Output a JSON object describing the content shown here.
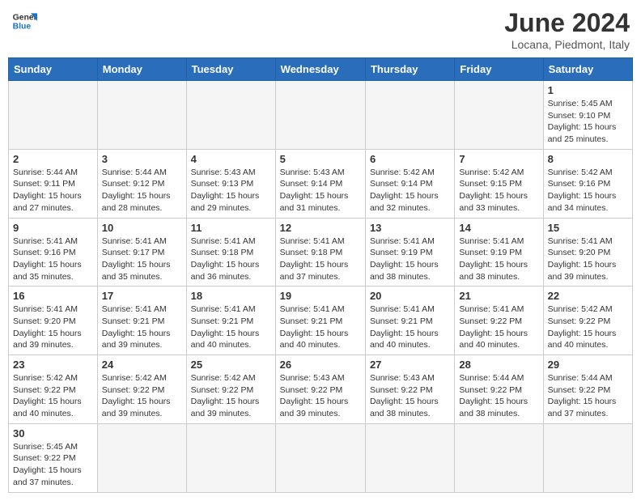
{
  "header": {
    "logo_general": "General",
    "logo_blue": "Blue",
    "title": "June 2024",
    "subtitle": "Locana, Piedmont, Italy"
  },
  "days_of_week": [
    "Sunday",
    "Monday",
    "Tuesday",
    "Wednesday",
    "Thursday",
    "Friday",
    "Saturday"
  ],
  "weeks": [
    [
      {
        "day": "",
        "info": ""
      },
      {
        "day": "",
        "info": ""
      },
      {
        "day": "",
        "info": ""
      },
      {
        "day": "",
        "info": ""
      },
      {
        "day": "",
        "info": ""
      },
      {
        "day": "",
        "info": ""
      },
      {
        "day": "1",
        "info": "Sunrise: 5:45 AM\nSunset: 9:10 PM\nDaylight: 15 hours and 25 minutes."
      }
    ],
    [
      {
        "day": "2",
        "info": "Sunrise: 5:44 AM\nSunset: 9:11 PM\nDaylight: 15 hours and 27 minutes."
      },
      {
        "day": "3",
        "info": "Sunrise: 5:44 AM\nSunset: 9:12 PM\nDaylight: 15 hours and 28 minutes."
      },
      {
        "day": "4",
        "info": "Sunrise: 5:43 AM\nSunset: 9:13 PM\nDaylight: 15 hours and 29 minutes."
      },
      {
        "day": "5",
        "info": "Sunrise: 5:43 AM\nSunset: 9:14 PM\nDaylight: 15 hours and 31 minutes."
      },
      {
        "day": "6",
        "info": "Sunrise: 5:42 AM\nSunset: 9:14 PM\nDaylight: 15 hours and 32 minutes."
      },
      {
        "day": "7",
        "info": "Sunrise: 5:42 AM\nSunset: 9:15 PM\nDaylight: 15 hours and 33 minutes."
      },
      {
        "day": "8",
        "info": "Sunrise: 5:42 AM\nSunset: 9:16 PM\nDaylight: 15 hours and 34 minutes."
      }
    ],
    [
      {
        "day": "9",
        "info": "Sunrise: 5:41 AM\nSunset: 9:16 PM\nDaylight: 15 hours and 35 minutes."
      },
      {
        "day": "10",
        "info": "Sunrise: 5:41 AM\nSunset: 9:17 PM\nDaylight: 15 hours and 35 minutes."
      },
      {
        "day": "11",
        "info": "Sunrise: 5:41 AM\nSunset: 9:18 PM\nDaylight: 15 hours and 36 minutes."
      },
      {
        "day": "12",
        "info": "Sunrise: 5:41 AM\nSunset: 9:18 PM\nDaylight: 15 hours and 37 minutes."
      },
      {
        "day": "13",
        "info": "Sunrise: 5:41 AM\nSunset: 9:19 PM\nDaylight: 15 hours and 38 minutes."
      },
      {
        "day": "14",
        "info": "Sunrise: 5:41 AM\nSunset: 9:19 PM\nDaylight: 15 hours and 38 minutes."
      },
      {
        "day": "15",
        "info": "Sunrise: 5:41 AM\nSunset: 9:20 PM\nDaylight: 15 hours and 39 minutes."
      }
    ],
    [
      {
        "day": "16",
        "info": "Sunrise: 5:41 AM\nSunset: 9:20 PM\nDaylight: 15 hours and 39 minutes."
      },
      {
        "day": "17",
        "info": "Sunrise: 5:41 AM\nSunset: 9:21 PM\nDaylight: 15 hours and 39 minutes."
      },
      {
        "day": "18",
        "info": "Sunrise: 5:41 AM\nSunset: 9:21 PM\nDaylight: 15 hours and 40 minutes."
      },
      {
        "day": "19",
        "info": "Sunrise: 5:41 AM\nSunset: 9:21 PM\nDaylight: 15 hours and 40 minutes."
      },
      {
        "day": "20",
        "info": "Sunrise: 5:41 AM\nSunset: 9:21 PM\nDaylight: 15 hours and 40 minutes."
      },
      {
        "day": "21",
        "info": "Sunrise: 5:41 AM\nSunset: 9:22 PM\nDaylight: 15 hours and 40 minutes."
      },
      {
        "day": "22",
        "info": "Sunrise: 5:42 AM\nSunset: 9:22 PM\nDaylight: 15 hours and 40 minutes."
      }
    ],
    [
      {
        "day": "23",
        "info": "Sunrise: 5:42 AM\nSunset: 9:22 PM\nDaylight: 15 hours and 40 minutes."
      },
      {
        "day": "24",
        "info": "Sunrise: 5:42 AM\nSunset: 9:22 PM\nDaylight: 15 hours and 39 minutes."
      },
      {
        "day": "25",
        "info": "Sunrise: 5:42 AM\nSunset: 9:22 PM\nDaylight: 15 hours and 39 minutes."
      },
      {
        "day": "26",
        "info": "Sunrise: 5:43 AM\nSunset: 9:22 PM\nDaylight: 15 hours and 39 minutes."
      },
      {
        "day": "27",
        "info": "Sunrise: 5:43 AM\nSunset: 9:22 PM\nDaylight: 15 hours and 38 minutes."
      },
      {
        "day": "28",
        "info": "Sunrise: 5:44 AM\nSunset: 9:22 PM\nDaylight: 15 hours and 38 minutes."
      },
      {
        "day": "29",
        "info": "Sunrise: 5:44 AM\nSunset: 9:22 PM\nDaylight: 15 hours and 37 minutes."
      }
    ],
    [
      {
        "day": "30",
        "info": "Sunrise: 5:45 AM\nSunset: 9:22 PM\nDaylight: 15 hours and 37 minutes."
      },
      {
        "day": "",
        "info": ""
      },
      {
        "day": "",
        "info": ""
      },
      {
        "day": "",
        "info": ""
      },
      {
        "day": "",
        "info": ""
      },
      {
        "day": "",
        "info": ""
      },
      {
        "day": "",
        "info": ""
      }
    ]
  ]
}
